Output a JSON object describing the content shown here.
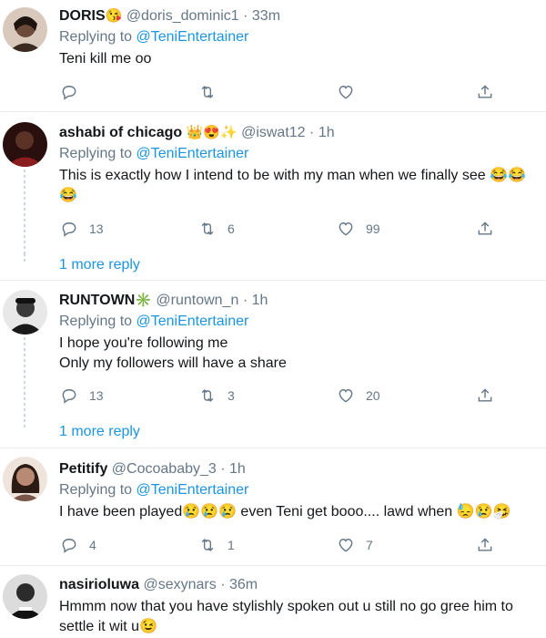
{
  "tweets": [
    {
      "name": "DORIS",
      "emoji": "😘",
      "handle": "@doris_dominic1",
      "dot": "·",
      "time": "33m",
      "replying_prefix": "Replying to",
      "replying_to": "@TeniEntertainer",
      "body": "Teni kill me oo",
      "replies": "",
      "retweets": "",
      "likes": "",
      "avatar_color": "#6b4a3a"
    },
    {
      "name": "ashabi of chicago",
      "emoji": "👑😍✨",
      "handle": "@iswat12",
      "dot": "·",
      "time": "1h",
      "replying_prefix": "Replying to",
      "replying_to": "@TeniEntertainer",
      "body": "This is exactly how I intend to be with my man when we finally see 😂😂😂",
      "replies": "13",
      "retweets": "6",
      "likes": "99",
      "avatar_color": "#8a1d1d"
    },
    {
      "name": "RUNTOWN",
      "emoji": "✳️",
      "handle": "@runtown_n",
      "dot": "·",
      "time": "1h",
      "replying_prefix": "Replying to",
      "replying_to": "@TeniEntertainer",
      "body_line1": "I hope you're following me",
      "body_line2": "Only my followers will have a share",
      "replies": "13",
      "retweets": "3",
      "likes": "20",
      "avatar_color": "#3a3a3a"
    },
    {
      "name": "Petitify",
      "emoji": "",
      "handle": "@Cocoababy_3",
      "dot": "·",
      "time": "1h",
      "replying_prefix": "Replying to",
      "replying_to": "@TeniEntertainer",
      "body": "I have been played😢😢😢 even Teni get booo.... lawd when 😓😢🤧",
      "replies": "4",
      "retweets": "1",
      "likes": "7",
      "avatar_color": "#b98a73"
    },
    {
      "name": "nasirioluwa",
      "emoji": "",
      "handle": "@sexynars",
      "dot": "·",
      "time": "36m",
      "body": "Hmmm now that you have stylishly spoken out u still no go gree him to settle it wit u😉",
      "avatar_color": "#2b2b2b"
    }
  ],
  "more_replies": [
    "1 more reply",
    "1 more reply"
  ],
  "colors": {
    "link": "#1b95e0",
    "muted": "#657786",
    "divider": "#e6ecf0"
  },
  "icons": [
    "reply-icon",
    "retweet-icon",
    "like-icon",
    "share-icon"
  ]
}
